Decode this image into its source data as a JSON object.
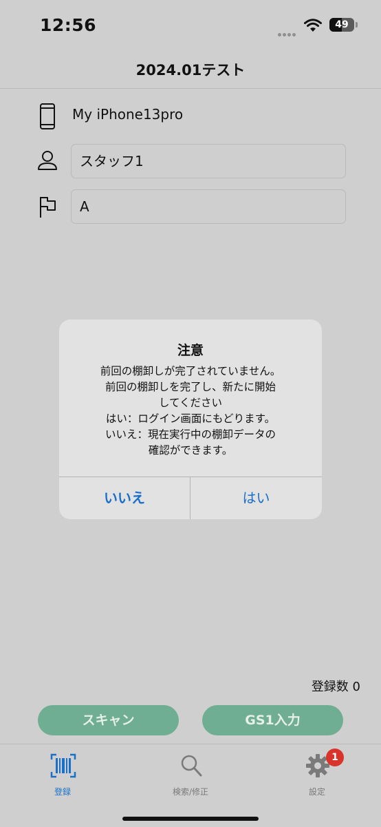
{
  "status_bar": {
    "time": "12:56",
    "battery_level": "49",
    "battery_fraction": 0.49,
    "cell_signal": "no-service-dots",
    "wifi": "wifi-icon"
  },
  "nav": {
    "title": "2024.01テスト"
  },
  "form": {
    "device_icon": "phone-icon",
    "device_name": "My iPhone13pro",
    "staff_icon": "person-icon",
    "staff_value": "スタッフ1",
    "location_icon": "flag-icon",
    "location_value": "A"
  },
  "dialog": {
    "title": "注意",
    "message_lines": [
      "前回の棚卸しが完了されていません。",
      "前回の棚卸しを完了し、新たに開始",
      "してください",
      "はい：ログイン画面にもどります。",
      "いいえ：現在実行中の棚卸データの",
      "確認ができます。"
    ],
    "no_label": "いいえ",
    "yes_label": "はい"
  },
  "summary": {
    "count_text": "登録数 0"
  },
  "actions": {
    "scan_label": "スキャン",
    "gs1_label": "GS1入力"
  },
  "tabs": [
    {
      "label": "登録",
      "icon": "barcode-icon",
      "active": true
    },
    {
      "label": "検索/修正",
      "icon": "magnifier-icon",
      "active": false
    },
    {
      "label": "設定",
      "icon": "gear-icon",
      "active": false,
      "badge": "1"
    }
  ],
  "colors": {
    "accent_blue": "#1a6fc9",
    "button_green": "#6fae92",
    "badge_red": "#d8342c",
    "dimmed_background": "#cfcfcf"
  }
}
